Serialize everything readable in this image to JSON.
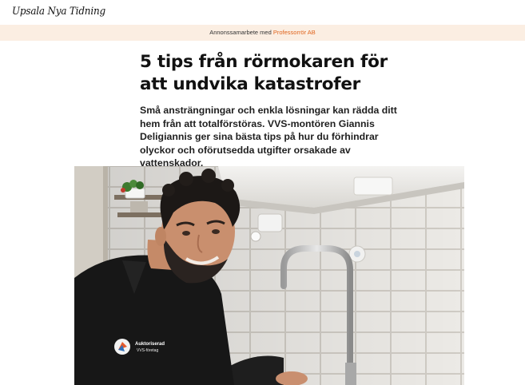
{
  "site": {
    "logo_text": "Upsala Nya Tidning"
  },
  "ad_banner": {
    "prefix": "Annonssamarbete med",
    "sponsor": "Professorrör AB"
  },
  "article": {
    "headline": "5 tips från rörmokaren för att undvika katastrofer",
    "lead": "Små ansträngningar och enkla lösningar kan rädda ditt hem från att totalförstöras. VVS-montören Giannis Deligiannis ger sina bästa tips på hur du förhindrar olyckor och oförutsedda utgifter orsakade av vattenskador."
  },
  "photo": {
    "shirt_logo_line1": "Auktoriserad",
    "shirt_logo_line2": "VVS-företag"
  },
  "colors": {
    "ad_background": "#fbeee2",
    "sponsor_link": "#e0651e"
  }
}
